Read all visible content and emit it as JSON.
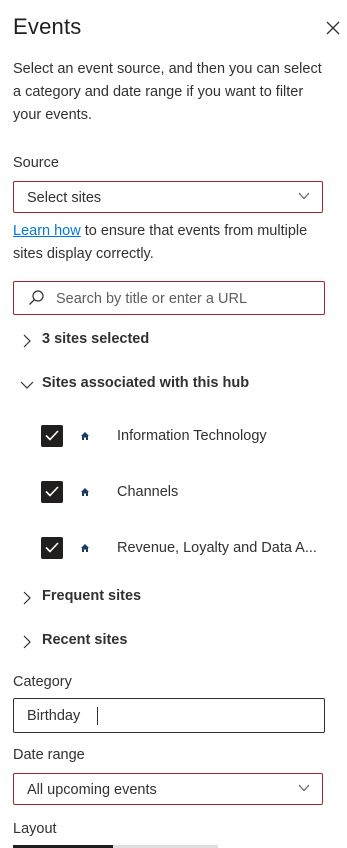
{
  "panel": {
    "title": "Events",
    "description": "Select an event source, and then you can select a category and date range if you want to filter your events.",
    "close_icon": "close-icon"
  },
  "source": {
    "label": "Source",
    "selected": "Select sites",
    "info_link": "Learn how",
    "info_text": " to ensure that events from multiple sites display correctly."
  },
  "search": {
    "placeholder": "Search by title or enter a URL",
    "value": ""
  },
  "groups": {
    "selected": {
      "label": "3 sites selected",
      "expanded": false
    },
    "hub": {
      "label": "Sites associated with this hub",
      "expanded": true
    },
    "frequent": {
      "label": "Frequent sites",
      "expanded": false
    },
    "recent": {
      "label": "Recent sites",
      "expanded": false
    }
  },
  "hub_sites": [
    {
      "name": "Information Technology",
      "checked": true,
      "icon": "home-icon"
    },
    {
      "name": "Channels",
      "checked": true,
      "icon": "home-icon"
    },
    {
      "name": "Revenue, Loyalty and Data A...",
      "checked": true,
      "icon": "home-icon"
    }
  ],
  "category": {
    "label": "Category",
    "value": "Birthday"
  },
  "date_range": {
    "label": "Date range",
    "selected": "All upcoming events"
  },
  "layout": {
    "label": "Layout"
  },
  "colors": {
    "error_border": "#a4262c",
    "link": "#0078d4",
    "checkbox": "#201f1e",
    "home_icon": "#1b3a6b"
  }
}
